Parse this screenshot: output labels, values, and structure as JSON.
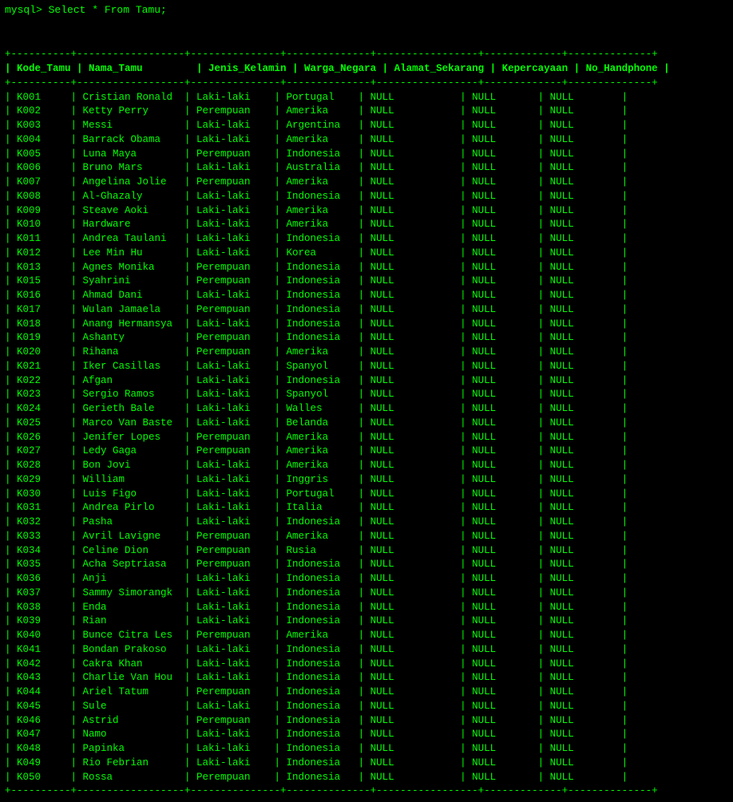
{
  "terminal": {
    "prompt": "mysql> Select * From Tamu;",
    "columns": [
      "Kode_Tamu",
      "Nama_Tamu",
      "Jenis_Kelamin",
      "Warga_Negara",
      "Alamat_Sekarang",
      "Kepercayaan",
      "No_Handphone"
    ],
    "divider": "+----------+------------------+---------------+--------------+-----------------+-------------+--------------+",
    "header": "| Kode_Tamu | Nama_Tamu         | Jenis_Kelamin | Warga_Negara | Alamat_Sekarang | Kepercayaan | No_Handphone |",
    "rows": [
      [
        "K001",
        "Cristian Ronald",
        "Laki-laki",
        "Portugal",
        "NULL",
        "NULL",
        "NULL"
      ],
      [
        "K002",
        "Ketty Perry",
        "Perempuan",
        "Amerika",
        "NULL",
        "NULL",
        "NULL"
      ],
      [
        "K003",
        "Messi",
        "Laki-laki",
        "Argentina",
        "NULL",
        "NULL",
        "NULL"
      ],
      [
        "K004",
        "Barrack Obama",
        "Laki-laki",
        "Amerika",
        "NULL",
        "NULL",
        "NULL"
      ],
      [
        "K005",
        "Luna Maya",
        "Perempuan",
        "Indonesia",
        "NULL",
        "NULL",
        "NULL"
      ],
      [
        "K006",
        "Bruno Mars",
        "Laki-laki",
        "Australia",
        "NULL",
        "NULL",
        "NULL"
      ],
      [
        "K007",
        "Angelina Jolie",
        "Perempuan",
        "Amerika",
        "NULL",
        "NULL",
        "NULL"
      ],
      [
        "K008",
        "Al-Ghazaly",
        "Laki-laki",
        "Indonesia",
        "NULL",
        "NULL",
        "NULL"
      ],
      [
        "K009",
        "Steave Aoki",
        "Laki-laki",
        "Amerika",
        "NULL",
        "NULL",
        "NULL"
      ],
      [
        "K010",
        "Hardware",
        "Laki-laki",
        "Amerika",
        "NULL",
        "NULL",
        "NULL"
      ],
      [
        "K011",
        "Andrea Taulani",
        "Laki-laki",
        "Indonesia",
        "NULL",
        "NULL",
        "NULL"
      ],
      [
        "K012",
        "Lee Min Hu",
        "Laki-laki",
        "Korea",
        "NULL",
        "NULL",
        "NULL"
      ],
      [
        "K013",
        "Agnes Monika",
        "Perempuan",
        "Indonesia",
        "NULL",
        "NULL",
        "NULL"
      ],
      [
        "K015",
        "Syahrini",
        "Perempuan",
        "Indonesia",
        "NULL",
        "NULL",
        "NULL"
      ],
      [
        "K016",
        "Ahmad Dani",
        "Laki-laki",
        "Indonesia",
        "NULL",
        "NULL",
        "NULL"
      ],
      [
        "K017",
        "Wulan Jamaela",
        "Perempuan",
        "Indonesia",
        "NULL",
        "NULL",
        "NULL"
      ],
      [
        "K018",
        "Anang Hermansya",
        "Laki-laki",
        "Indonesia",
        "NULL",
        "NULL",
        "NULL"
      ],
      [
        "K019",
        "Ashanty",
        "Perempuan",
        "Indonesia",
        "NULL",
        "NULL",
        "NULL"
      ],
      [
        "K020",
        "Rihana",
        "Perempuan",
        "Amerika",
        "NULL",
        "NULL",
        "NULL"
      ],
      [
        "K021",
        "Iker Casillas",
        "Laki-laki",
        "Spanyol",
        "NULL",
        "NULL",
        "NULL"
      ],
      [
        "K022",
        "Afgan",
        "Laki-laki",
        "Indonesia",
        "NULL",
        "NULL",
        "NULL"
      ],
      [
        "K023",
        "Sergio Ramos",
        "Laki-laki",
        "Spanyol",
        "NULL",
        "NULL",
        "NULL"
      ],
      [
        "K024",
        "Gerieth Bale",
        "Laki-laki",
        "Walles",
        "NULL",
        "NULL",
        "NULL"
      ],
      [
        "K025",
        "Marco Van Baste",
        "Laki-laki",
        "Belanda",
        "NULL",
        "NULL",
        "NULL"
      ],
      [
        "K026",
        "Jenifer Lopes",
        "Perempuan",
        "Amerika",
        "NULL",
        "NULL",
        "NULL"
      ],
      [
        "K027",
        "Ledy Gaga",
        "Perempuan",
        "Amerika",
        "NULL",
        "NULL",
        "NULL"
      ],
      [
        "K028",
        "Bon Jovi",
        "Laki-laki",
        "Amerika",
        "NULL",
        "NULL",
        "NULL"
      ],
      [
        "K029",
        "William",
        "Laki-laki",
        "Inggris",
        "NULL",
        "NULL",
        "NULL"
      ],
      [
        "K030",
        "Luis Figo",
        "Laki-laki",
        "Portugal",
        "NULL",
        "NULL",
        "NULL"
      ],
      [
        "K031",
        "Andrea Pirlo",
        "Laki-laki",
        "Italia",
        "NULL",
        "NULL",
        "NULL"
      ],
      [
        "K032",
        "Pasha",
        "Laki-laki",
        "Indonesia",
        "NULL",
        "NULL",
        "NULL"
      ],
      [
        "K033",
        "Avril Lavigne",
        "Perempuan",
        "Amerika",
        "NULL",
        "NULL",
        "NULL"
      ],
      [
        "K034",
        "Celine Dion",
        "Perempuan",
        "Rusia",
        "NULL",
        "NULL",
        "NULL"
      ],
      [
        "K035",
        "Acha Septriasa",
        "Perempuan",
        "Indonesia",
        "NULL",
        "NULL",
        "NULL"
      ],
      [
        "K036",
        "Anji",
        "Laki-laki",
        "Indonesia",
        "NULL",
        "NULL",
        "NULL"
      ],
      [
        "K037",
        "Sammy Simorangk",
        "Laki-laki",
        "Indonesia",
        "NULL",
        "NULL",
        "NULL"
      ],
      [
        "K038",
        "Enda",
        "Laki-laki",
        "Indonesia",
        "NULL",
        "NULL",
        "NULL"
      ],
      [
        "K039",
        "Rian",
        "Laki-laki",
        "Indonesia",
        "NULL",
        "NULL",
        "NULL"
      ],
      [
        "K040",
        "Bunce Citra Les",
        "Perempuan",
        "Amerika",
        "NULL",
        "NULL",
        "NULL"
      ],
      [
        "K041",
        "Bondan Prakoso",
        "Laki-laki",
        "Indonesia",
        "NULL",
        "NULL",
        "NULL"
      ],
      [
        "K042",
        "Cakra Khan",
        "Laki-laki",
        "Indonesia",
        "NULL",
        "NULL",
        "NULL"
      ],
      [
        "K043",
        "Charlie Van Hou",
        "Laki-laki",
        "Indonesia",
        "NULL",
        "NULL",
        "NULL"
      ],
      [
        "K044",
        "Ariel Tatum",
        "Perempuan",
        "Indonesia",
        "NULL",
        "NULL",
        "NULL"
      ],
      [
        "K045",
        "Sule",
        "Laki-laki",
        "Indonesia",
        "NULL",
        "NULL",
        "NULL"
      ],
      [
        "K046",
        "Astrid",
        "Perempuan",
        "Indonesia",
        "NULL",
        "NULL",
        "NULL"
      ],
      [
        "K047",
        "Namo",
        "Laki-laki",
        "Indonesia",
        "NULL",
        "NULL",
        "NULL"
      ],
      [
        "K048",
        "Papinka",
        "Laki-laki",
        "Indonesia",
        "NULL",
        "NULL",
        "NULL"
      ],
      [
        "K049",
        "Rio Febrian",
        "Laki-laki",
        "Indonesia",
        "NULL",
        "NULL",
        "NULL"
      ],
      [
        "K050",
        "Rossa",
        "Perempuan",
        "Indonesia",
        "NULL",
        "NULL",
        "NULL"
      ]
    ]
  }
}
